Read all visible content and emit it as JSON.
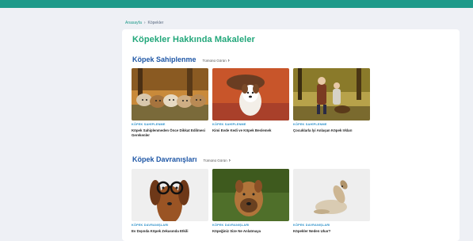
{
  "breadcrumb": {
    "home": "Anasayfa",
    "separator": "›",
    "current": "Köpekler"
  },
  "page": {
    "title": "Köpekler Hakkında Makaleler"
  },
  "sections": [
    {
      "title": "Köpek Sahiplenme",
      "see_all": "Tümünü Görün",
      "articles": [
        {
          "category": "KÖPEK SAHİPLENME",
          "title": "Köpek Sahiplenmeden Önce Dikkat Edilmesi Gerekenler",
          "image_icon": "puppies-photo"
        },
        {
          "category": "KÖPEK SAHİPLENME",
          "title": "Kimi Evde Kedi ve Köpek Beslemek",
          "image_icon": "dog-and-cat-photo"
        },
        {
          "category": "KÖPEK SAHİPLENME",
          "title": "Çocuklarla İyi Anlaşan Köpek Irkları",
          "image_icon": "children-with-dog-photo"
        }
      ]
    },
    {
      "title": "Köpek Davranışları",
      "see_all": "Tümünü Görün",
      "articles": [
        {
          "category": "KÖPEK DAVRANIŞLARI",
          "title": "Ev Dışında Köpek Zekasında Etkili",
          "image_icon": "dachshund-glasses-photo"
        },
        {
          "category": "KÖPEK DAVRANIŞLARI",
          "title": "Köpeğiniz Size Ne Anlatmaya",
          "image_icon": "boxer-dog-photo"
        },
        {
          "category": "KÖPEK DAVRANIŞLARI",
          "title": "Köpekler Neden Uluır?",
          "image_icon": "howling-dog-photo"
        }
      ]
    }
  ],
  "colors": {
    "topbar": "#1e9a8a",
    "title": "#22a77a",
    "section_title": "#1f57a6",
    "category": "#2a8fc8"
  }
}
